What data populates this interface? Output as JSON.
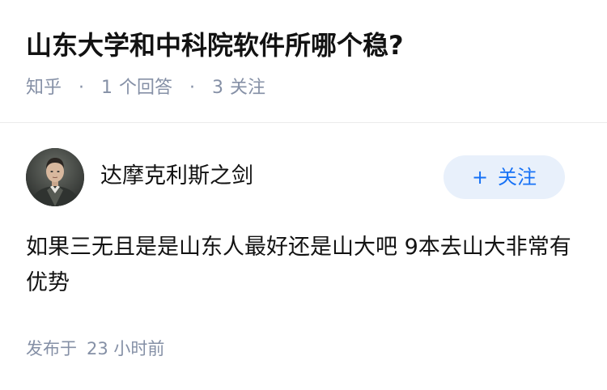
{
  "question": {
    "title": "山东大学和中科院软件所哪个稳?",
    "source": "知乎",
    "separator": "·",
    "answer_count": "1",
    "answer_label": "个回答",
    "follow_count": "3",
    "follow_label": "关注"
  },
  "answer": {
    "author": {
      "name": "达摩克利斯之剑",
      "avatar_icon": "user-avatar"
    },
    "follow_button": {
      "icon": "+",
      "label": "关注"
    },
    "content": "如果三无且是是山东人最好还是山大吧 9本去山大非常有优势",
    "published_label": "发布于",
    "published_time": "23 小时前"
  },
  "colors": {
    "title": "#121212",
    "meta": "#8590a6",
    "accent": "#1772f6",
    "follow_bg": "#e8f0fb",
    "divider": "#ebebeb"
  }
}
